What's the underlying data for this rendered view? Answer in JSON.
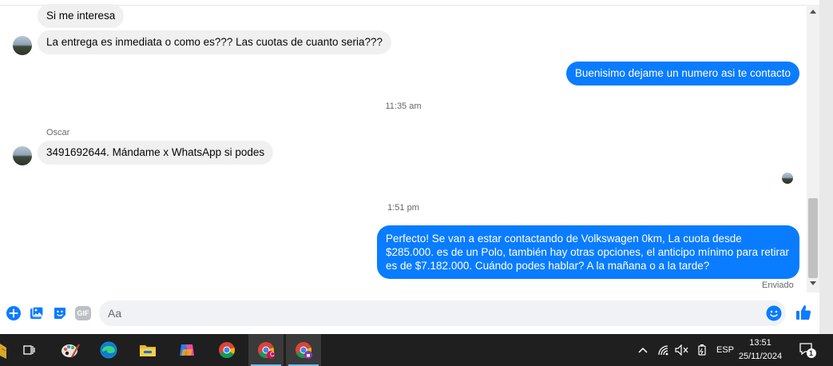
{
  "conversation": {
    "messages": [
      {
        "direction": "in",
        "text": "Si me interesa"
      },
      {
        "direction": "in",
        "text": "La entrega es inmediata o como es??? Las cuotas de cuanto seria???"
      },
      {
        "direction": "out",
        "text": "Buenisimo dejame un numero asi te contacto"
      },
      {
        "direction": "time",
        "text": "11:35 am"
      },
      {
        "direction": "sender",
        "text": "Oscar"
      },
      {
        "direction": "in",
        "text": "3491692644. Mándame x WhatsApp si podes"
      },
      {
        "direction": "time",
        "text": "1:51 pm"
      },
      {
        "direction": "out",
        "text": "Perfecto!  Se van a estar contactando de Volkswagen 0km, La cuota desde $285.000. es de un Polo, también hay otras opciones, el anticipo mínimo para retirar es de $7.182.000. Cuándo podes hablar? A la mañana o a la tarde?"
      },
      {
        "direction": "status",
        "text": "Enviado"
      }
    ]
  },
  "composer": {
    "placeholder": "Aa",
    "icons": [
      "plus-icon",
      "image-icon",
      "sticker-icon",
      "gif-icon",
      "emoji-icon",
      "thumbs-up-icon"
    ],
    "gif_label": "GIF"
  },
  "taskbar": {
    "apps": [
      "task-view-icon",
      "paint-icon",
      "edge-icon",
      "file-explorer-icon",
      "copilot-icon",
      "chrome-icon",
      "chrome-profile-c-icon",
      "chrome-profile-lock-icon"
    ],
    "profile_letter": "C",
    "tray": {
      "language": "ESP",
      "time": "13:51",
      "date": "25/11/2024",
      "notification_count": "1"
    }
  },
  "colors": {
    "outgoing_bubble": "#0a7cff",
    "incoming_bubble": "#f0f0f0",
    "messenger_accent": "#0a7cff",
    "taskbar": "#1f1f1f"
  }
}
